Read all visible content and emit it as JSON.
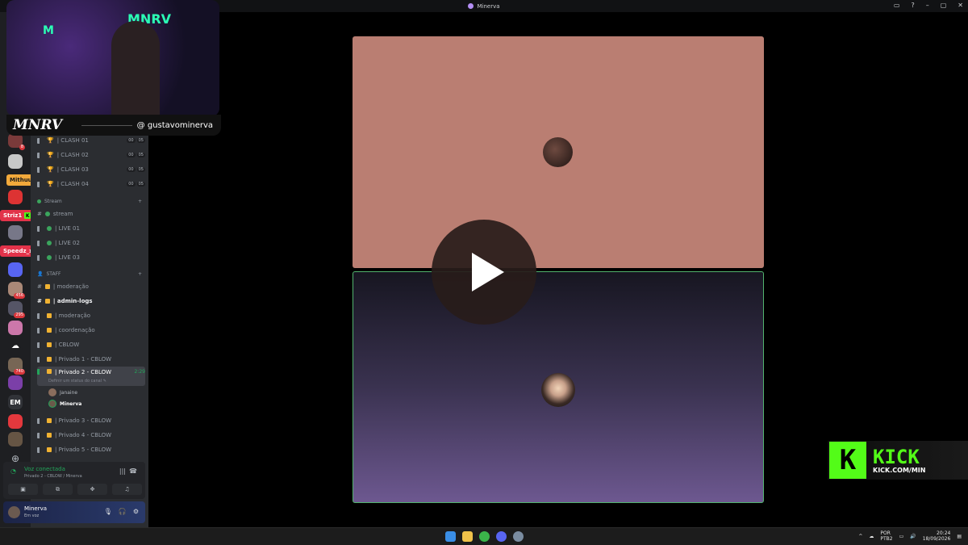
{
  "window": {
    "title": "Minerva"
  },
  "webcam": {
    "brand": "MNRV",
    "handle": "@ gustavominerva",
    "neon_left": "M",
    "neon_right": "MNRV"
  },
  "rail_tags": [
    {
      "label": "Mithuu1",
      "bg": "#f2a93b",
      "color": "#1a1a1a"
    },
    {
      "label": "Striz1",
      "bg": "#e2334a",
      "color": "#ffffff"
    },
    {
      "label": "Speedz_x",
      "bg": "#e2334a",
      "color": "#ffffff"
    }
  ],
  "rail_badges": [
    "8",
    "456",
    "295",
    "740",
    "EM"
  ],
  "channels": {
    "clash": [
      {
        "name": "| CLASH 01",
        "a": "00",
        "b": "05"
      },
      {
        "name": "| CLASH 02",
        "a": "00",
        "b": "05"
      },
      {
        "name": "| CLASH 03",
        "a": "00",
        "b": "05"
      },
      {
        "name": "| CLASH 04",
        "a": "00",
        "b": "05"
      }
    ],
    "stream_category": "Stream",
    "stream": [
      "stream",
      "| LIVE 01",
      "| LIVE 02",
      "| LIVE 03"
    ],
    "staff_category": "STAFF",
    "staff": [
      "| moderação",
      "| admin-logs",
      "| moderação",
      "| coordenação",
      "| CBLOW",
      "| Privado 1 - CBLOW"
    ],
    "active": {
      "name": "| Privado 2 - CBLOW",
      "time": "2:29",
      "status": "Definir um status do canal"
    },
    "members": [
      "Janaine",
      "Minerva"
    ],
    "after": [
      "| Privado 3 - CBLOW",
      "| Privado 4 - CBLOW",
      "| Privado 5 - CBLOW"
    ]
  },
  "voice": {
    "status": "Voz conectada",
    "location": "Privado 2 - CBLOW / Minerva"
  },
  "user": {
    "name": "Minerva",
    "status": "Em voz"
  },
  "kick": {
    "mark": "K",
    "word": "KICK",
    "url": "KICK.COM/MIN"
  },
  "taskbar": {
    "lang_top": "POR",
    "lang_bottom": "PTB2",
    "time": "20:24",
    "date": "18/09/2026"
  },
  "colors": {
    "accent": "#53fc18",
    "speaking": "#52b46e",
    "tile_top": "#ba7e72"
  }
}
